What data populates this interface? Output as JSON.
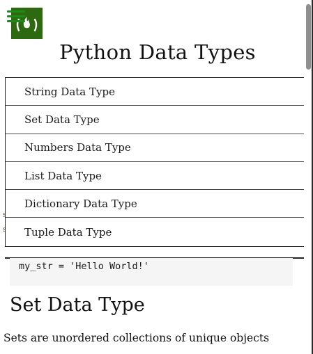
{
  "header": {
    "logo_icon": "freecodecamp-fire-icon",
    "menu_icon": "hamburger-menu-icon",
    "title": "Python Data Types"
  },
  "nav": {
    "items": [
      {
        "label": "String Data Type"
      },
      {
        "label": "Set Data Type"
      },
      {
        "label": "Numbers Data Type"
      },
      {
        "label": "List Data Type"
      },
      {
        "label": "Dictionary Data Type"
      },
      {
        "label": "Tuple Data Type"
      }
    ]
  },
  "content": {
    "code": "my_str = 'Hello World!'",
    "section_heading": "Set Data Type",
    "section_text": "Sets are unordered collections of unique objects"
  },
  "colors": {
    "logo_bg": "#2d6a0f",
    "menu_icon": "#1d8a1a",
    "code_bg": "#f5f5f5"
  }
}
